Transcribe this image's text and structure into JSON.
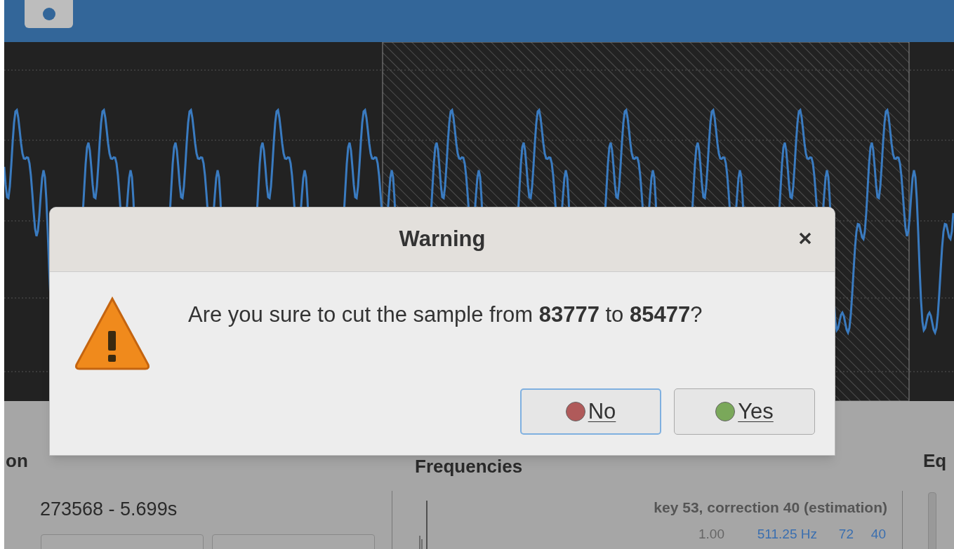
{
  "dialog": {
    "title": "Warning",
    "message": "Are you sure to cut the sample from **83777** to **85477**?",
    "buttons": [
      {
        "label": "No",
        "kind": "no",
        "focused": true
      },
      {
        "label": "Yes",
        "kind": "yes",
        "focused": false
      }
    ]
  },
  "panel": {
    "section_left": "on",
    "position": "273568 - 5.699s",
    "section_middle": "Frequencies",
    "estimation": "key 53, correction 40 (estimation)",
    "frequency_row": [
      "1.00",
      "511.25 Hz",
      "72",
      "40"
    ],
    "section_right": "Eq"
  }
}
